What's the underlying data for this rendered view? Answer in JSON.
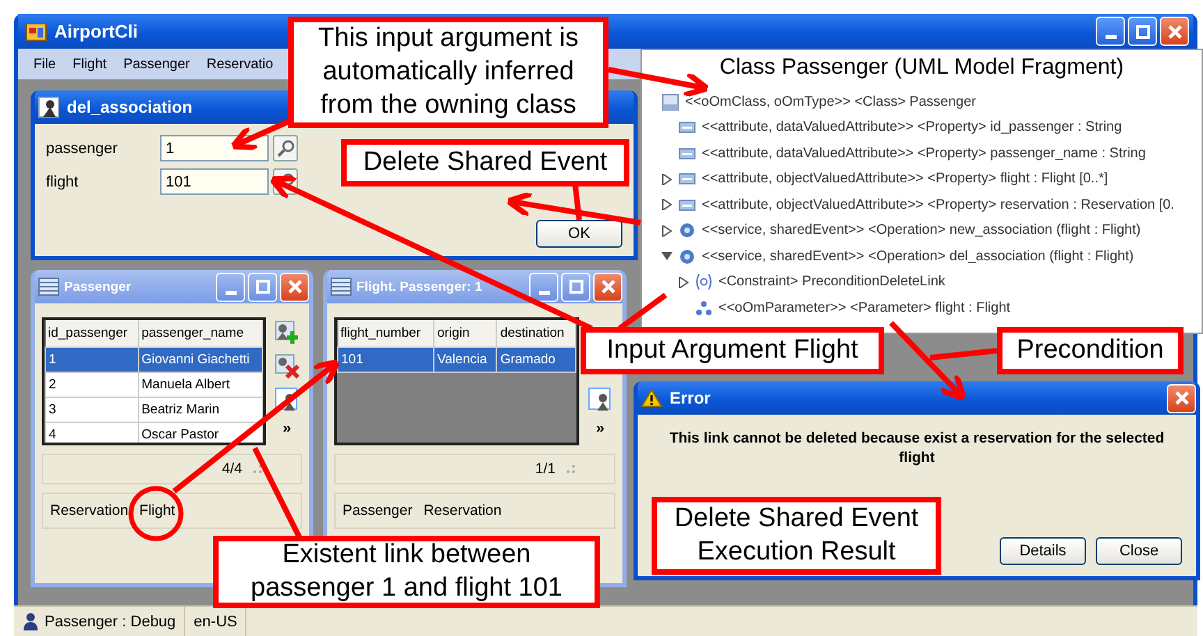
{
  "window": {
    "title": "AirportCli"
  },
  "menu": [
    "File",
    "Flight",
    "Passenger",
    "Reservatio"
  ],
  "del_association": {
    "title": "del_association",
    "fields": [
      {
        "label": "passenger",
        "value": "1"
      },
      {
        "label": "flight",
        "value": "101"
      }
    ],
    "buttons": [
      "OK"
    ]
  },
  "uml_panel": {
    "title": "Class Passenger (UML Model Fragment)",
    "tree": [
      {
        "kind": "class",
        "text": "<<oOmClass, oOmType>> <Class> Passenger",
        "children": [
          {
            "kind": "attribute",
            "text": "<<attribute, dataValuedAttribute>> <Property> id_passenger : String"
          },
          {
            "kind": "attribute",
            "text": "<<attribute, dataValuedAttribute>> <Property> passenger_name : String"
          },
          {
            "kind": "attribute",
            "text": "<<attribute, objectValuedAttribute>> <Property> flight : Flight [0..*]",
            "expanded": false
          },
          {
            "kind": "attribute",
            "text": "<<attribute, objectValuedAttribute>> <Property> reservation : Reservation [0.",
            "expanded": false
          },
          {
            "kind": "operation",
            "text": "<<service, sharedEvent>> <Operation> new_association (flight : Flight)",
            "expanded": false
          },
          {
            "kind": "operation",
            "text": "<<service, sharedEvent>> <Operation> del_association (flight : Flight)",
            "expanded": true,
            "children": [
              {
                "kind": "constraint",
                "text": "<Constraint> PreconditionDeleteLink",
                "expanded": false
              },
              {
                "kind": "parameter",
                "text": "<<oOmParameter>> <Parameter> flight : Flight"
              }
            ]
          }
        ]
      }
    ]
  },
  "passenger_window": {
    "title": "Passenger",
    "columns": [
      "id_passenger",
      "passenger_name"
    ],
    "rows": [
      {
        "cells": [
          "1",
          "Giovanni Giachetti"
        ],
        "selected": true
      },
      {
        "cells": [
          "2",
          "Manuela Albert"
        ],
        "selected": false
      },
      {
        "cells": [
          "3",
          "Beatriz Marin"
        ],
        "selected": false
      },
      {
        "cells": [
          "4",
          "Oscar Pastor"
        ],
        "selected": false
      }
    ],
    "more": "»",
    "pager": "4/4",
    "links": [
      "Reservation",
      "Flight"
    ]
  },
  "flight_window": {
    "title": "Flight. Passenger: 1",
    "columns": [
      "flight_number",
      "origin",
      "destination"
    ],
    "rows": [
      {
        "cells": [
          "101",
          "Valencia",
          "Gramado"
        ],
        "selected": true
      }
    ],
    "more": "»",
    "pager": "1/1",
    "links": [
      "Passenger",
      "Reservation"
    ]
  },
  "error_dialog": {
    "title": "Error",
    "message": "This link cannot be deleted because exist a reservation for the selected flight",
    "buttons": [
      "Details",
      "Close"
    ]
  },
  "status_bar": [
    "Passenger : Debug",
    "en-US"
  ],
  "callouts": [
    "This input argument is automatically inferred from the owning class",
    "Delete Shared Event",
    "Input Argument Flight",
    "Precondition",
    "Delete Shared Event Execution Result",
    "Existent link between passenger 1 and flight 101"
  ]
}
